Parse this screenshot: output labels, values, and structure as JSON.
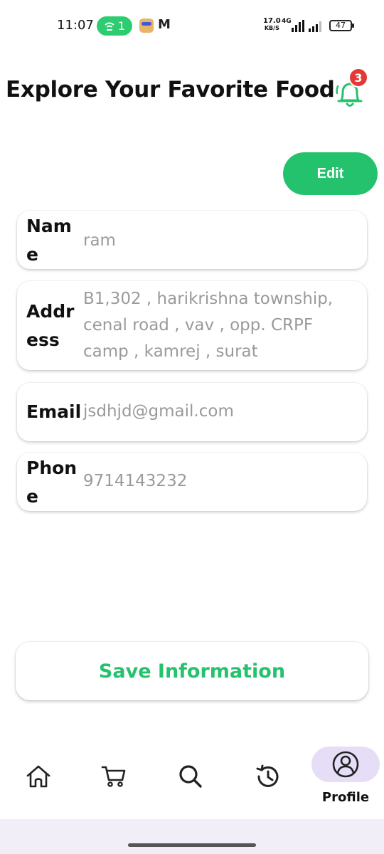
{
  "status_bar": {
    "time": "11:07",
    "hotspot_count": "1",
    "gmail_glyph": "M",
    "net_speed_value": "17.0",
    "net_speed_unit": "KB/S",
    "network_type": "4G",
    "battery": "47"
  },
  "header": {
    "title": "Explore Your Favorite Food",
    "notification_count": "3",
    "icon": "bell-icon"
  },
  "edit_button": {
    "label": "Edit"
  },
  "fields": [
    {
      "label_line1": "Nam",
      "label_line2": "e",
      "value": "ram"
    },
    {
      "label_line1": "Addr",
      "label_line2": "ess",
      "value_lines": [
        "B1,302 , harikrishna township,",
        "cenal road , vav , opp. CRPF",
        "camp , kamrej , surat"
      ]
    },
    {
      "label": "Email",
      "value": "jsdhjd@gmail.com"
    },
    {
      "label_line1": "Phon",
      "label_line2": "e",
      "value": "9714143232"
    }
  ],
  "save_button": {
    "label": "Save Information"
  },
  "bottom_nav": {
    "items": [
      {
        "icon": "home-icon"
      },
      {
        "icon": "cart-icon"
      },
      {
        "icon": "search-icon"
      },
      {
        "icon": "history-icon"
      },
      {
        "icon": "profile-icon",
        "label": "Profile",
        "active": true
      }
    ]
  },
  "colors": {
    "accent_green": "#25c26e",
    "badge_red": "#e53935",
    "active_pill": "#e6def7"
  }
}
